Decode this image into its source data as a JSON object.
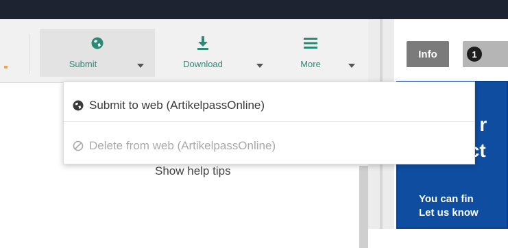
{
  "toolbar": {
    "submit_label": "Submit",
    "download_label": "Download",
    "more_label": "More"
  },
  "dropdown": {
    "items": [
      {
        "label": "Submit to web (ArtikelpassOnline)",
        "icon": "globe-icon",
        "enabled": true
      },
      {
        "label": "Delete from web (ArtikelpassOnline)",
        "icon": "prohibited-icon",
        "enabled": false
      }
    ]
  },
  "main": {
    "help_tips_label": "Show help tips"
  },
  "right_panel": {
    "tab_info": "Info",
    "tab_badge": "1",
    "banner_heading_line1": "e r",
    "banner_heading_line2": "ict",
    "banner_text_line1": "You can fin",
    "banner_text_line2": "Let us know"
  },
  "colors": {
    "accent": "#2a8a75",
    "topbar": "#1d2331",
    "banner": "#0e4da0"
  }
}
